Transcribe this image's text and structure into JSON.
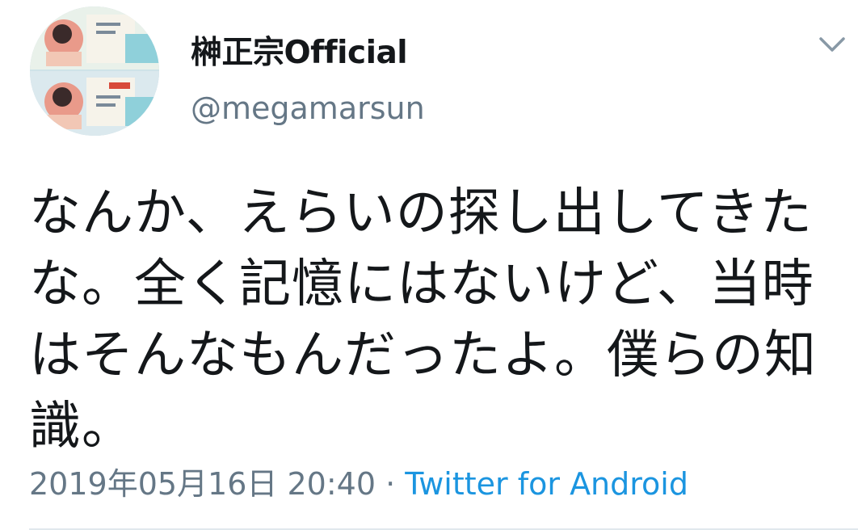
{
  "user": {
    "display_name": "榊正宗Official",
    "handle": "@megamarsun",
    "avatar_icon": "profile-avatar-icon"
  },
  "menu": {
    "icon": "chevron-down-icon"
  },
  "tweet": {
    "text": "なんか、えらいの探し出してきたな。全く記憶にはないけど、当時はそんなもんだったよ。僕らの知識。",
    "timestamp": "2019年05月16日 20:40",
    "separator": "·",
    "source": "Twitter for Android"
  },
  "colors": {
    "text_primary": "#14171a",
    "text_secondary": "#657786",
    "link": "#1b95e0",
    "divider": "#e1e8ed"
  }
}
